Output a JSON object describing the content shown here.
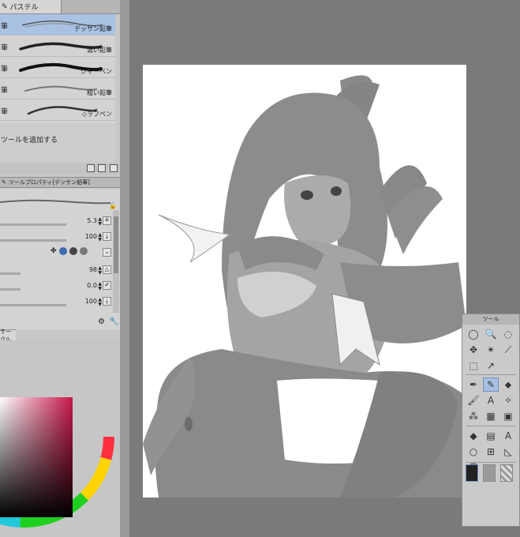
{
  "sub_tool_panel": {
    "tab_label": "パステル",
    "brushes": [
      {
        "prefix": "筆",
        "name": "デッサン鉛筆",
        "selected": true
      },
      {
        "prefix": "筆",
        "name": "濃い鉛筆",
        "selected": false
      },
      {
        "prefix": "筆",
        "name": "シャーペン",
        "selected": false
      },
      {
        "prefix": "筆",
        "name": "粗い鉛筆",
        "selected": false
      },
      {
        "prefix": "筆",
        "name": "◇ラフペン",
        "selected": false
      }
    ],
    "add_tool_label": "ツールを追加する"
  },
  "tool_property": {
    "header": "ツールプロパティ[デッサン鉛筆]",
    "rows": [
      {
        "value": "5.3",
        "fill": 0.58
      },
      {
        "value": "100",
        "fill": 0.58
      },
      {
        "value": "",
        "fill": 0
      },
      {
        "value": "98",
        "fill": 0.18
      },
      {
        "value": "0.0",
        "fill": 0.18
      },
      {
        "value": "100",
        "fill": 0.58
      }
    ]
  },
  "color_panel": {
    "tab_label": "サークル",
    "hue_color": "#c8174a"
  },
  "tool_palette": {
    "title": "ツール"
  },
  "colors": {
    "selection": "#a9c2e4",
    "panel": "#c8c8c8",
    "workspace": "#7a7a7a"
  }
}
